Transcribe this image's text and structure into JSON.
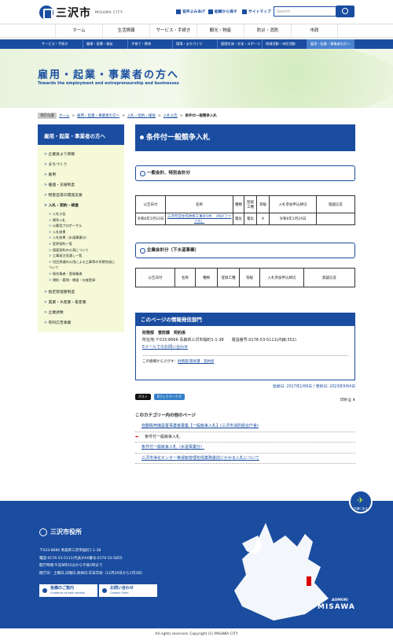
{
  "header": {
    "city_name": "三沢市",
    "city_en": "MISAMA CITY",
    "util_links": [
      "音声よみあげ",
      "組織から探す",
      "サイトマップ"
    ],
    "search_placeholder": "Search"
  },
  "global_nav": [
    "ホーム",
    "生活情報",
    "サービス・手続き",
    "観光・物産",
    "防災・消防",
    "市政"
  ],
  "sub_nav": [
    "サービス・手続き",
    "健康・医療・福祉",
    "子育て・教育",
    "環境・まちづくり",
    "国際交流・文化・スポーツ",
    "地域活動・市民活動",
    "雇用・起業・事業者の方へ"
  ],
  "hero": {
    "title": "雇用・起業・事業者の方へ",
    "subtitle": "Towards the employment and entrepreneurship and businesses"
  },
  "breadcrumb": {
    "label": "現在位置",
    "items": [
      "ホーム",
      "雇用・起業・事業者の方へ",
      "入札・契約・検査",
      "入札公告",
      "条件付一般競争入札"
    ]
  },
  "sidebar": {
    "title": "雇用・起業・事業者の方へ",
    "items": [
      "企業貢より情報",
      "まちづくり",
      "雇用",
      "優遇・支援制度",
      "物産品等の開発支援",
      "入札・契約・検査"
    ],
    "subitems": [
      "入札公告",
      "競争入札",
      "公募型プロポーザル",
      "入札結果",
      "入札結果（水道事業分）",
      "変更契約一覧",
      "随意契約の公表について",
      "工事発注見通し一覧",
      "切目停通の公用による工事等の早期完成について",
      "指名業者・登録業者",
      "規則・要領・様道・口座登録"
    ],
    "items2": [
      "指定管理者制度",
      "農業・水産業・畜産業",
      "企業誘致",
      "有料広告事業"
    ]
  },
  "main": {
    "page_title": "条件付一般競争入札",
    "section1": {
      "heading": "一般会計、特別会計分",
      "headers": [
        "公告日付",
        "名称",
        "種類",
        "登録工種",
        "等級",
        "入札参加申込締切",
        "質疑応答"
      ],
      "rows": [
        [
          "令和6年1月10日",
          "三沢市営住宅改修工事外5件　（PDFファイル）",
          "電気",
          "電気",
          "A",
          "令和6年1月24日",
          ""
        ]
      ]
    },
    "section2": {
      "heading": "企業会計分（下水道事業）",
      "headers": [
        "公告日付",
        "名称",
        "種類",
        "登録工種",
        "等級",
        "入札参加申込締切",
        "質疑応答"
      ]
    },
    "info": {
      "heading": "このページの情報発信部門",
      "dept": "財務部　管財課　契約係",
      "address": "所在地:〒033-8666 青森県三沢市桜町1-1-38　　電話番号:0176-53-5111(内線:352)",
      "email_link": "Eメールでのお問い合わせ",
      "other_label": "この組織からさがす：",
      "other_link": "財務部/管財課　契約係"
    },
    "dates": "登録日: 2017年1月6日 / 更新日: 2023年9月4日",
    "share": [
      "ポスト",
      "Bブックマーク 0"
    ],
    "print_label": "印刷",
    "related_title": "このカテゴリー内の他のページ",
    "related": [
      "自動販売機設置事業者募集【一般競争入札】(三沢市消防組合庁舎)",
      "条件付一般競争入札",
      "条件付一般競争入札（水道事業分）",
      "三沢市浄化センター等運転管理包括業務委託にかかる入札について"
    ]
  },
  "footer": {
    "office": "三沢市役所",
    "address": "〒033-8666 青森県三沢市桜町1-1-38",
    "tel": "電話:0176-53-5111(代表)FAX番号:0176-52-5855",
    "hours": "開庁時間:午前8時15分から午後5時まで",
    "closed": "閉庁日：土曜日,日曜日,祝休日,年末年始（12月29日から1月3日）",
    "btn1": "各課のご案内",
    "btn1_sub": "Guidance of each section",
    "btn2": "お問い合わせ",
    "btn2_sub": "Contact Form",
    "map_label1": "AOMORI",
    "map_label2": "MISAWA",
    "totop": "先頭に戻る"
  },
  "copyright": "All rights reserved. Copyright (C) MISAWA CITY"
}
